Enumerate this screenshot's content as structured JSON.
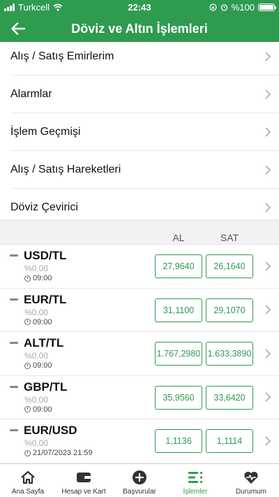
{
  "status_bar": {
    "carrier": "Turkcell",
    "time": "22:43",
    "battery": "%100"
  },
  "header": {
    "title": "Döviz ve Altın İşlemleri"
  },
  "menu": [
    {
      "label": "Alış / Satış Emirlerim"
    },
    {
      "label": "Alarmlar"
    },
    {
      "label": "İşlem Geçmişi"
    },
    {
      "label": "Alış / Satış Hareketleri"
    },
    {
      "label": "Döviz Çevirici"
    }
  ],
  "rates_header": {
    "buy": "AL",
    "sell": "SAT"
  },
  "rates": [
    {
      "pair": "USD/TL",
      "change": "%0,00",
      "time": "09:00",
      "buy": "27,9640",
      "sell": "26,1640"
    },
    {
      "pair": "EUR/TL",
      "change": "%0,00",
      "time": "09:00",
      "buy": "31,1100",
      "sell": "29,1070"
    },
    {
      "pair": "ALT/TL",
      "change": "%0,00",
      "time": "09:00",
      "buy": "1.767,2980",
      "sell": "1.633,3890"
    },
    {
      "pair": "GBP/TL",
      "change": "%0,00",
      "time": "09:00",
      "buy": "35,9560",
      "sell": "33,6420"
    },
    {
      "pair": "EUR/USD",
      "change": "%0,00",
      "time": "21/07/2023 21:59",
      "buy": "1,1136",
      "sell": "1,1114"
    }
  ],
  "tabs": [
    {
      "label": "Ana Sayfa",
      "icon": "home-icon"
    },
    {
      "label": "Hesap ve Kart",
      "icon": "wallet-icon"
    },
    {
      "label": "Başvurular",
      "icon": "plus-circle-icon"
    },
    {
      "label": "İşlemler",
      "icon": "list-icon",
      "active": true
    },
    {
      "label": "Durumum",
      "icon": "heart-pulse-icon"
    }
  ],
  "colors": {
    "brand_green": "#2f9b4f",
    "chevron_gray": "#b0b0b0"
  }
}
